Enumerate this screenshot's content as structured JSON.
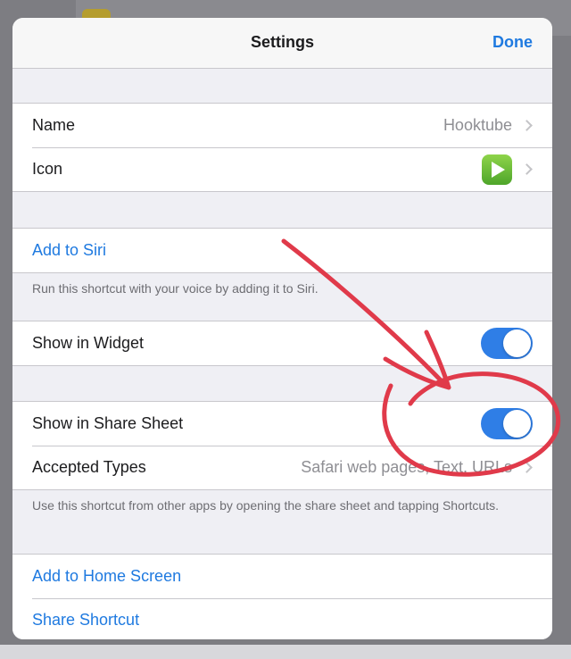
{
  "navbar": {
    "title": "Settings",
    "done_label": "Done"
  },
  "general": {
    "name_label": "Name",
    "name_value": "Hooktube",
    "icon_label": "Icon",
    "icon_name": "green-play-icon"
  },
  "siri": {
    "add_label": "Add to Siri",
    "note": "Run this shortcut with your voice by adding it to Siri."
  },
  "widget": {
    "label": "Show in Widget",
    "enabled": true
  },
  "share_sheet": {
    "label": "Show in Share Sheet",
    "enabled": true,
    "accepted_types_label": "Accepted Types",
    "accepted_types_value": "Safari web pages, Text, URLs",
    "note": "Use this shortcut from other apps by opening the share sheet and tapping Shortcuts."
  },
  "actions": {
    "home_screen_label": "Add to Home Screen",
    "share_label": "Share Shortcut"
  },
  "colors": {
    "accent": "#1f7ae0",
    "toggle_on": "#2f7ee6",
    "annotation": "#e03a4a"
  }
}
